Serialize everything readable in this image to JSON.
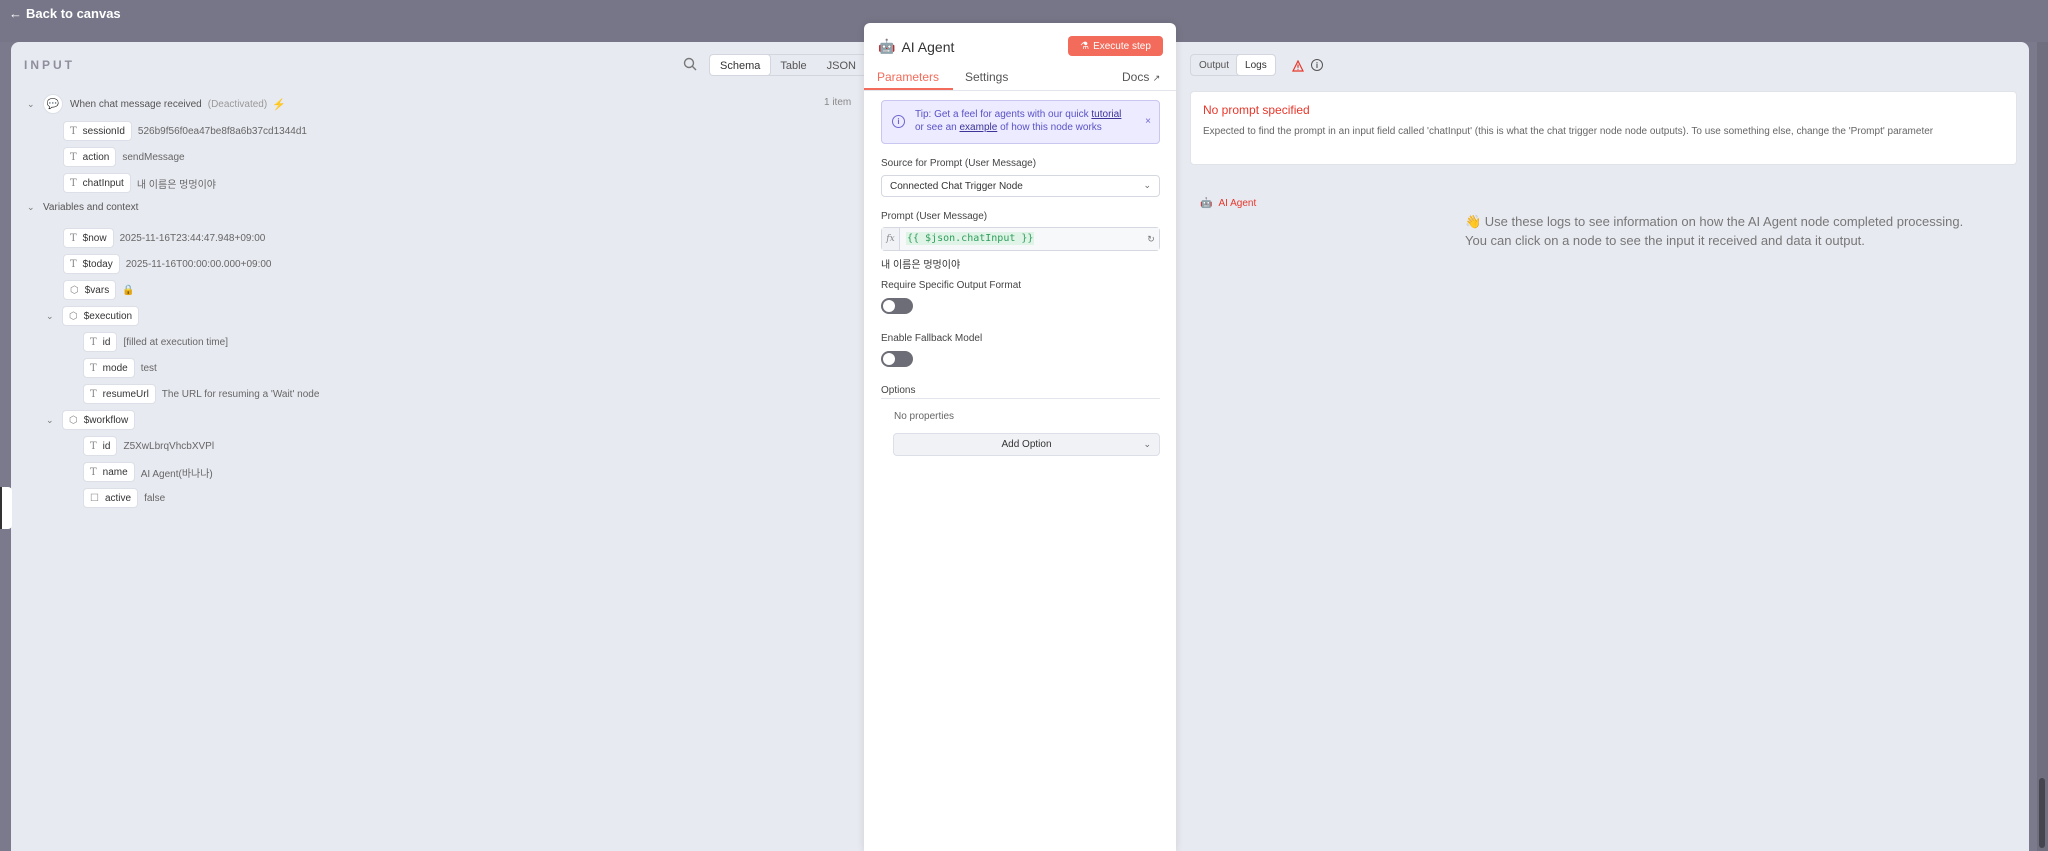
{
  "nav": {
    "back_label": "Back to canvas"
  },
  "input": {
    "heading": "INPUT",
    "view_tabs": [
      "Schema",
      "Table",
      "JSON"
    ],
    "active_tab": "Schema",
    "trigger": {
      "name": "When chat message received",
      "status": "(Deactivated)",
      "count": "1 item"
    },
    "trigger_fields": [
      {
        "key": "sessionId",
        "value": "526b9f56f0ea47be8f8a6b37cd1344d1"
      },
      {
        "key": "action",
        "value": "sendMessage"
      },
      {
        "key": "chatInput",
        "value": "내 이름은 멍멍이야"
      }
    ],
    "vars_section": "Variables and context",
    "vars": [
      {
        "key": "$now",
        "value": "2025-11-16T23:44:47.948+09:00"
      },
      {
        "key": "$today",
        "value": "2025-11-16T00:00:00.000+09:00"
      },
      {
        "key": "$vars",
        "value": ""
      }
    ],
    "execution": {
      "key": "$execution",
      "fields": [
        {
          "key": "id",
          "value": "[filled at execution time]"
        },
        {
          "key": "mode",
          "value": "test"
        },
        {
          "key": "resumeUrl",
          "value": "The URL for resuming a 'Wait' node"
        }
      ]
    },
    "workflow": {
      "key": "$workflow",
      "fields": [
        {
          "key": "id",
          "value": "Z5XwLbrqVhcbXVPl"
        },
        {
          "key": "name",
          "value": "AI Agent(바나나)"
        },
        {
          "key": "active",
          "value": "false"
        }
      ]
    }
  },
  "node": {
    "title": "AI Agent",
    "execute_label": "Execute step",
    "tabs": [
      "Parameters",
      "Settings",
      "Docs"
    ],
    "tip": {
      "p1": "Tip: Get a feel for agents with our quick ",
      "link1": "tutorial",
      "p2": "or see an ",
      "link2": "example",
      "p3": " of how this node works",
      "close": "×"
    },
    "source_label": "Source for Prompt (User Message)",
    "source_value": "Connected Chat Trigger Node",
    "prompt_label": "Prompt (User Message)",
    "prompt_expr": "{{ $json.chatInput }}",
    "prompt_preview": "내 이름은 멍멍이야",
    "output_format_label": "Require Specific Output Format",
    "fallback_label": "Enable Fallback Model",
    "options_label": "Options",
    "no_props": "No properties",
    "add_option": "Add Option"
  },
  "output": {
    "tabs": [
      "Output",
      "Logs"
    ],
    "active_tab": "Logs",
    "error_title": "No prompt specified",
    "error_desc": "Expected to find the prompt in an input field called 'chatInput' (this is what the chat trigger node node outputs). To use something else, change the 'Prompt' parameter",
    "log_entry": "AI Agent",
    "hint_line1": "👋 Use these logs to see information on how the AI Agent node completed processing.",
    "hint_line2": "You can click on a node to see the input it received and data it output."
  },
  "colors": {
    "accent": "#f36b5a",
    "error": "#e8372a",
    "tip_bg": "#ecebff"
  }
}
